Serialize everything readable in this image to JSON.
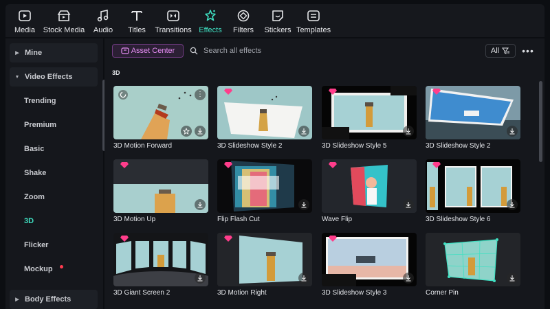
{
  "toolbar": {
    "items": [
      {
        "label": "Media",
        "icon": "media-icon"
      },
      {
        "label": "Stock Media",
        "icon": "stock-media-icon"
      },
      {
        "label": "Audio",
        "icon": "audio-icon"
      },
      {
        "label": "Titles",
        "icon": "titles-icon"
      },
      {
        "label": "Transitions",
        "icon": "transitions-icon"
      },
      {
        "label": "Effects",
        "icon": "effects-icon"
      },
      {
        "label": "Filters",
        "icon": "filters-icon"
      },
      {
        "label": "Stickers",
        "icon": "stickers-icon"
      },
      {
        "label": "Templates",
        "icon": "templates-icon"
      }
    ],
    "active": "Effects"
  },
  "sidebar": {
    "items": [
      {
        "label": "Mine"
      },
      {
        "label": "Video Effects"
      },
      {
        "label": "Trending"
      },
      {
        "label": "Premium"
      },
      {
        "label": "Basic"
      },
      {
        "label": "Shake"
      },
      {
        "label": "Zoom"
      },
      {
        "label": "3D"
      },
      {
        "label": "Flicker"
      },
      {
        "label": "Mockup"
      },
      {
        "label": "Body Effects"
      }
    ],
    "active": "3D"
  },
  "main": {
    "asset_center_label": "Asset Center",
    "search_placeholder": "Search all effects",
    "filter_label": "All",
    "more_label": "•••",
    "section_title": "3D"
  },
  "effects": [
    {
      "label": "3D Motion Forward"
    },
    {
      "label": "3D Slideshow Style 2"
    },
    {
      "label": "3D Slideshow Style 5"
    },
    {
      "label": "3D Slideshow Style 2"
    },
    {
      "label": "3D Motion Up"
    },
    {
      "label": "Flip Flash Cut"
    },
    {
      "label": "Wave Flip"
    },
    {
      "label": "3D Slideshow Style 6"
    },
    {
      "label": "3D Giant Screen 2"
    },
    {
      "label": "3D Motion Right"
    },
    {
      "label": "3D Slideshow Style 3"
    },
    {
      "label": "Corner Pin"
    }
  ],
  "colors": {
    "accent": "#3fe0c2",
    "premium": "#ff3d8b",
    "asset_center": "#e78ef5",
    "new_dot": "#ff3b4f"
  }
}
